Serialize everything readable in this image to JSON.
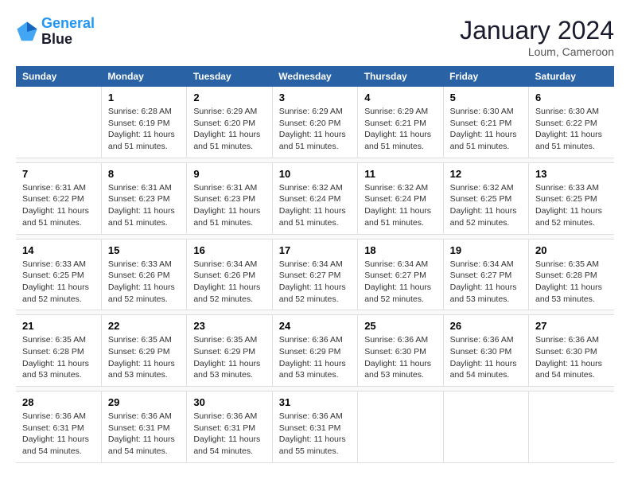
{
  "logo": {
    "line1": "General",
    "line2": "Blue"
  },
  "title": "January 2024",
  "location": "Loum, Cameroon",
  "weekdays": [
    "Sunday",
    "Monday",
    "Tuesday",
    "Wednesday",
    "Thursday",
    "Friday",
    "Saturday"
  ],
  "weeks": [
    [
      {
        "day": "",
        "sunrise": "",
        "sunset": "",
        "daylight": ""
      },
      {
        "day": "1",
        "sunrise": "Sunrise: 6:28 AM",
        "sunset": "Sunset: 6:19 PM",
        "daylight": "Daylight: 11 hours and 51 minutes."
      },
      {
        "day": "2",
        "sunrise": "Sunrise: 6:29 AM",
        "sunset": "Sunset: 6:20 PM",
        "daylight": "Daylight: 11 hours and 51 minutes."
      },
      {
        "day": "3",
        "sunrise": "Sunrise: 6:29 AM",
        "sunset": "Sunset: 6:20 PM",
        "daylight": "Daylight: 11 hours and 51 minutes."
      },
      {
        "day": "4",
        "sunrise": "Sunrise: 6:29 AM",
        "sunset": "Sunset: 6:21 PM",
        "daylight": "Daylight: 11 hours and 51 minutes."
      },
      {
        "day": "5",
        "sunrise": "Sunrise: 6:30 AM",
        "sunset": "Sunset: 6:21 PM",
        "daylight": "Daylight: 11 hours and 51 minutes."
      },
      {
        "day": "6",
        "sunrise": "Sunrise: 6:30 AM",
        "sunset": "Sunset: 6:22 PM",
        "daylight": "Daylight: 11 hours and 51 minutes."
      }
    ],
    [
      {
        "day": "7",
        "sunrise": "Sunrise: 6:31 AM",
        "sunset": "Sunset: 6:22 PM",
        "daylight": "Daylight: 11 hours and 51 minutes."
      },
      {
        "day": "8",
        "sunrise": "Sunrise: 6:31 AM",
        "sunset": "Sunset: 6:23 PM",
        "daylight": "Daylight: 11 hours and 51 minutes."
      },
      {
        "day": "9",
        "sunrise": "Sunrise: 6:31 AM",
        "sunset": "Sunset: 6:23 PM",
        "daylight": "Daylight: 11 hours and 51 minutes."
      },
      {
        "day": "10",
        "sunrise": "Sunrise: 6:32 AM",
        "sunset": "Sunset: 6:24 PM",
        "daylight": "Daylight: 11 hours and 51 minutes."
      },
      {
        "day": "11",
        "sunrise": "Sunrise: 6:32 AM",
        "sunset": "Sunset: 6:24 PM",
        "daylight": "Daylight: 11 hours and 51 minutes."
      },
      {
        "day": "12",
        "sunrise": "Sunrise: 6:32 AM",
        "sunset": "Sunset: 6:25 PM",
        "daylight": "Daylight: 11 hours and 52 minutes."
      },
      {
        "day": "13",
        "sunrise": "Sunrise: 6:33 AM",
        "sunset": "Sunset: 6:25 PM",
        "daylight": "Daylight: 11 hours and 52 minutes."
      }
    ],
    [
      {
        "day": "14",
        "sunrise": "Sunrise: 6:33 AM",
        "sunset": "Sunset: 6:25 PM",
        "daylight": "Daylight: 11 hours and 52 minutes."
      },
      {
        "day": "15",
        "sunrise": "Sunrise: 6:33 AM",
        "sunset": "Sunset: 6:26 PM",
        "daylight": "Daylight: 11 hours and 52 minutes."
      },
      {
        "day": "16",
        "sunrise": "Sunrise: 6:34 AM",
        "sunset": "Sunset: 6:26 PM",
        "daylight": "Daylight: 11 hours and 52 minutes."
      },
      {
        "day": "17",
        "sunrise": "Sunrise: 6:34 AM",
        "sunset": "Sunset: 6:27 PM",
        "daylight": "Daylight: 11 hours and 52 minutes."
      },
      {
        "day": "18",
        "sunrise": "Sunrise: 6:34 AM",
        "sunset": "Sunset: 6:27 PM",
        "daylight": "Daylight: 11 hours and 52 minutes."
      },
      {
        "day": "19",
        "sunrise": "Sunrise: 6:34 AM",
        "sunset": "Sunset: 6:27 PM",
        "daylight": "Daylight: 11 hours and 53 minutes."
      },
      {
        "day": "20",
        "sunrise": "Sunrise: 6:35 AM",
        "sunset": "Sunset: 6:28 PM",
        "daylight": "Daylight: 11 hours and 53 minutes."
      }
    ],
    [
      {
        "day": "21",
        "sunrise": "Sunrise: 6:35 AM",
        "sunset": "Sunset: 6:28 PM",
        "daylight": "Daylight: 11 hours and 53 minutes."
      },
      {
        "day": "22",
        "sunrise": "Sunrise: 6:35 AM",
        "sunset": "Sunset: 6:29 PM",
        "daylight": "Daylight: 11 hours and 53 minutes."
      },
      {
        "day": "23",
        "sunrise": "Sunrise: 6:35 AM",
        "sunset": "Sunset: 6:29 PM",
        "daylight": "Daylight: 11 hours and 53 minutes."
      },
      {
        "day": "24",
        "sunrise": "Sunrise: 6:36 AM",
        "sunset": "Sunset: 6:29 PM",
        "daylight": "Daylight: 11 hours and 53 minutes."
      },
      {
        "day": "25",
        "sunrise": "Sunrise: 6:36 AM",
        "sunset": "Sunset: 6:30 PM",
        "daylight": "Daylight: 11 hours and 53 minutes."
      },
      {
        "day": "26",
        "sunrise": "Sunrise: 6:36 AM",
        "sunset": "Sunset: 6:30 PM",
        "daylight": "Daylight: 11 hours and 54 minutes."
      },
      {
        "day": "27",
        "sunrise": "Sunrise: 6:36 AM",
        "sunset": "Sunset: 6:30 PM",
        "daylight": "Daylight: 11 hours and 54 minutes."
      }
    ],
    [
      {
        "day": "28",
        "sunrise": "Sunrise: 6:36 AM",
        "sunset": "Sunset: 6:31 PM",
        "daylight": "Daylight: 11 hours and 54 minutes."
      },
      {
        "day": "29",
        "sunrise": "Sunrise: 6:36 AM",
        "sunset": "Sunset: 6:31 PM",
        "daylight": "Daylight: 11 hours and 54 minutes."
      },
      {
        "day": "30",
        "sunrise": "Sunrise: 6:36 AM",
        "sunset": "Sunset: 6:31 PM",
        "daylight": "Daylight: 11 hours and 54 minutes."
      },
      {
        "day": "31",
        "sunrise": "Sunrise: 6:36 AM",
        "sunset": "Sunset: 6:31 PM",
        "daylight": "Daylight: 11 hours and 55 minutes."
      },
      {
        "day": "",
        "sunrise": "",
        "sunset": "",
        "daylight": ""
      },
      {
        "day": "",
        "sunrise": "",
        "sunset": "",
        "daylight": ""
      },
      {
        "day": "",
        "sunrise": "",
        "sunset": "",
        "daylight": ""
      }
    ]
  ]
}
